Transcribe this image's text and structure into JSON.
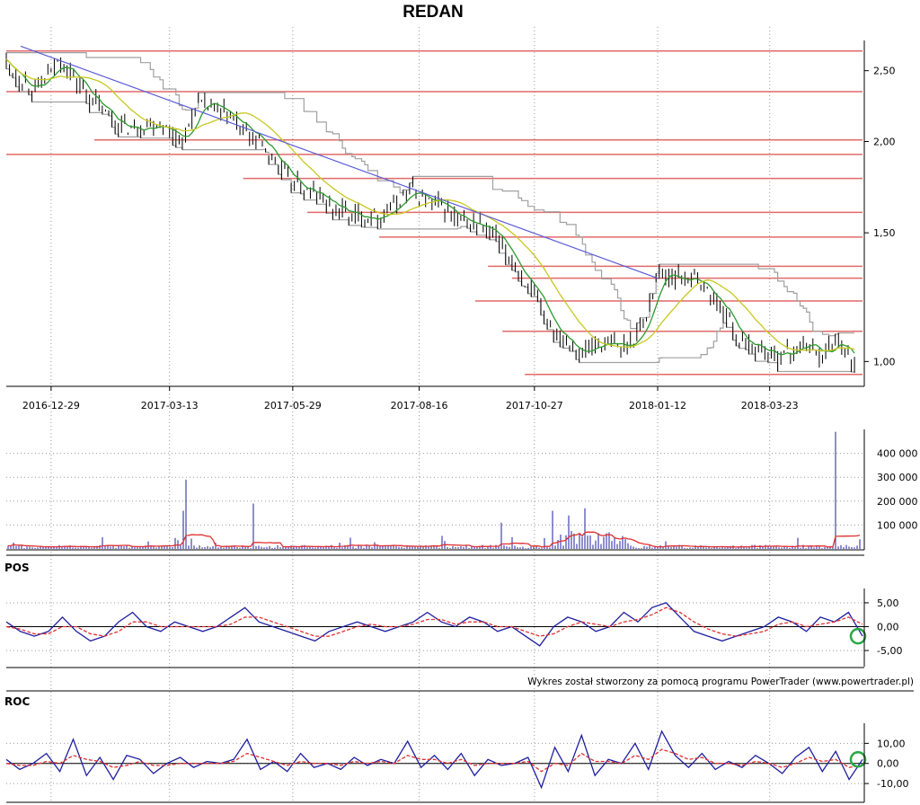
{
  "chart_data": [
    {
      "panel": "price",
      "type": "line",
      "title": "REDAN",
      "y_scale": "log",
      "ylim": [
        0.93,
        2.75
      ],
      "xlim": [
        "2016-12-01",
        "2018-05-20"
      ],
      "x_tick_labels": [
        "2016-12-29",
        "2017-03-13",
        "2017-05-29",
        "2017-08-16",
        "2017-10-27",
        "2018-01-12",
        "2018-03-23"
      ],
      "y_tick_labels": [
        {
          "value": 2.5,
          "label": "2,50"
        },
        {
          "value": 2.0,
          "label": "2,00"
        },
        {
          "value": 1.5,
          "label": "1,50"
        },
        {
          "value": 1.0,
          "label": "1,00"
        }
      ],
      "grid": "dotted-vertical",
      "price_series": [
        {
          "x": "2016-12-01",
          "y": 2.57
        },
        {
          "x": "2016-12-10",
          "y": 2.42
        },
        {
          "x": "2016-12-20",
          "y": 2.36
        },
        {
          "x": "2016-12-29",
          "y": 2.48
        },
        {
          "x": "2017-01-03",
          "y": 2.6
        },
        {
          "x": "2017-01-10",
          "y": 2.48
        },
        {
          "x": "2017-01-20",
          "y": 2.32
        },
        {
          "x": "2017-02-01",
          "y": 2.18
        },
        {
          "x": "2017-02-10",
          "y": 2.1
        },
        {
          "x": "2017-02-20",
          "y": 2.08
        },
        {
          "x": "2017-03-01",
          "y": 2.12
        },
        {
          "x": "2017-03-10",
          "y": 2.1
        },
        {
          "x": "2017-03-15",
          "y": 2.05
        },
        {
          "x": "2017-03-22",
          "y": 2.0
        },
        {
          "x": "2017-03-30",
          "y": 2.25
        },
        {
          "x": "2017-04-10",
          "y": 2.22
        },
        {
          "x": "2017-04-20",
          "y": 2.15
        },
        {
          "x": "2017-05-01",
          "y": 2.05
        },
        {
          "x": "2017-05-10",
          "y": 1.98
        },
        {
          "x": "2017-05-20",
          "y": 1.85
        },
        {
          "x": "2017-05-29",
          "y": 1.75
        },
        {
          "x": "2017-06-10",
          "y": 1.7
        },
        {
          "x": "2017-06-25",
          "y": 1.62
        },
        {
          "x": "2017-07-05",
          "y": 1.58
        },
        {
          "x": "2017-07-20",
          "y": 1.58
        },
        {
          "x": "2017-08-01",
          "y": 1.63
        },
        {
          "x": "2017-08-10",
          "y": 1.72
        },
        {
          "x": "2017-08-20",
          "y": 1.66
        },
        {
          "x": "2017-09-01",
          "y": 1.62
        },
        {
          "x": "2017-09-10",
          "y": 1.55
        },
        {
          "x": "2017-09-25",
          "y": 1.53
        },
        {
          "x": "2017-10-05",
          "y": 1.45
        },
        {
          "x": "2017-10-15",
          "y": 1.35
        },
        {
          "x": "2017-10-27",
          "y": 1.22
        },
        {
          "x": "2017-11-05",
          "y": 1.12
        },
        {
          "x": "2017-11-15",
          "y": 1.08
        },
        {
          "x": "2017-11-25",
          "y": 1.02
        },
        {
          "x": "2017-12-05",
          "y": 1.06
        },
        {
          "x": "2017-12-15",
          "y": 1.05
        },
        {
          "x": "2017-12-25",
          "y": 1.05
        },
        {
          "x": "2018-01-05",
          "y": 1.15
        },
        {
          "x": "2018-01-12",
          "y": 1.33
        },
        {
          "x": "2018-01-25",
          "y": 1.3
        },
        {
          "x": "2018-02-05",
          "y": 1.3
        },
        {
          "x": "2018-02-15",
          "y": 1.22
        },
        {
          "x": "2018-02-25",
          "y": 1.15
        },
        {
          "x": "2018-03-05",
          "y": 1.05
        },
        {
          "x": "2018-03-15",
          "y": 1.05
        },
        {
          "x": "2018-03-23",
          "y": 1.02
        },
        {
          "x": "2018-04-05",
          "y": 1.03
        },
        {
          "x": "2018-04-15",
          "y": 1.06
        },
        {
          "x": "2018-04-25",
          "y": 1.02
        },
        {
          "x": "2018-05-05",
          "y": 1.08
        },
        {
          "x": "2018-05-15",
          "y": 0.98
        }
      ],
      "trendline": {
        "from": {
          "x": "2016-12-10",
          "y": 2.7
        },
        "to": {
          "x": "2018-01-12",
          "y": 1.3
        },
        "color": "#5b5bd6"
      },
      "horizontal_levels": [
        {
          "y": 2.66,
          "from": "2016-12-01"
        },
        {
          "y": 2.34,
          "from": "2016-12-01"
        },
        {
          "y": 2.01,
          "from": "2017-01-25"
        },
        {
          "y": 1.92,
          "from": "2016-12-01"
        },
        {
          "y": 1.78,
          "from": "2017-04-28"
        },
        {
          "y": 1.6,
          "from": "2017-06-07"
        },
        {
          "y": 1.48,
          "from": "2017-07-22"
        },
        {
          "y": 1.35,
          "from": "2017-09-28"
        },
        {
          "y": 1.3,
          "from": "2017-10-13"
        },
        {
          "y": 1.21,
          "from": "2017-09-20"
        },
        {
          "y": 1.1,
          "from": "2017-10-07"
        },
        {
          "y": 0.96,
          "from": "2017-10-21"
        }
      ],
      "colors": {
        "price": "#000000",
        "ma_fast": "#2e9a2e",
        "ma_slow": "#c8c820",
        "channel": "#a0a0a0",
        "levels": "#e06a6a"
      }
    },
    {
      "panel": "volume",
      "type": "bar",
      "ylim": [
        0,
        500000
      ],
      "y_tick_labels": [
        {
          "value": 100000,
          "label": "100 000"
        },
        {
          "value": 200000,
          "label": "200 000"
        },
        {
          "value": 300000,
          "label": "300 000"
        },
        {
          "value": 400000,
          "label": "400 000"
        }
      ],
      "spikes": [
        {
          "x": "2017-03-23",
          "y": 290000
        },
        {
          "x": "2017-03-21",
          "y": 160000
        },
        {
          "x": "2017-05-04",
          "y": 190000
        },
        {
          "x": "2017-11-08",
          "y": 160000
        },
        {
          "x": "2017-11-28",
          "y": 170000
        },
        {
          "x": "2018-05-03",
          "y": 490000
        },
        {
          "x": "2017-10-07",
          "y": 110000
        },
        {
          "x": "2017-11-18",
          "y": 140000
        }
      ],
      "colors": {
        "bars": "#1e1ea0",
        "average": "#e03030"
      }
    },
    {
      "panel": "POS",
      "type": "line",
      "label": "POS",
      "ylim": [
        -8,
        8
      ],
      "y_tick_labels": [
        {
          "value": 5,
          "label": "5,00"
        },
        {
          "value": 0,
          "label": "0,00"
        },
        {
          "value": -5,
          "label": "-5,00"
        }
      ],
      "series": [
        {
          "values": [
            1,
            -1,
            -2,
            -1,
            2,
            -1,
            -3,
            -2,
            1,
            3,
            0,
            -1,
            1,
            0,
            -1,
            0,
            2,
            4,
            1,
            0,
            -1,
            -2,
            -3,
            -1,
            0,
            1,
            0,
            -1,
            0,
            1,
            3,
            1,
            0,
            2,
            1,
            -1,
            0,
            -2,
            -4,
            0,
            2,
            1,
            -1,
            0,
            3,
            1,
            4,
            5,
            2,
            -1,
            -2,
            -3,
            -2,
            -1,
            0,
            2,
            1,
            -1,
            2,
            1,
            3,
            -2
          ]
        },
        {
          "values": [
            0,
            -0.5,
            -1.5,
            -1.5,
            0,
            0,
            -1.5,
            -2,
            -1,
            1,
            1,
            0,
            0,
            0,
            0,
            0,
            0.5,
            2,
            2,
            1,
            0,
            -1,
            -2,
            -2,
            -1,
            0,
            0.5,
            0,
            0,
            0.5,
            1.5,
            1.5,
            0.5,
            1,
            1,
            0,
            0,
            -1,
            -2,
            -1.5,
            0,
            1,
            0.5,
            0,
            1,
            1.5,
            2.5,
            4,
            3,
            1,
            -0.5,
            -1.5,
            -2,
            -1.5,
            -1,
            0.5,
            1,
            0,
            0.5,
            1,
            2,
            0.5
          ]
        }
      ],
      "colors": {
        "series_1": "#1e1ea0",
        "series_2": "#e03030"
      }
    },
    {
      "panel": "ROC",
      "type": "line",
      "label": "ROC",
      "ylim": [
        -18,
        20
      ],
      "y_tick_labels": [
        {
          "value": 10,
          "label": "10,00"
        },
        {
          "value": 0,
          "label": "0,00"
        },
        {
          "value": -10,
          "label": "-10,00"
        }
      ],
      "series": [
        {
          "values": [
            2,
            -3,
            0,
            5,
            -4,
            12,
            -6,
            3,
            -8,
            4,
            2,
            -5,
            0,
            3,
            -2,
            1,
            0,
            2,
            12,
            -3,
            1,
            -4,
            5,
            -2,
            0,
            -3,
            3,
            -1,
            2,
            0,
            11,
            -2,
            4,
            -3,
            5,
            -6,
            2,
            -1,
            0,
            3,
            -12,
            8,
            -4,
            14,
            -6,
            2,
            0,
            10,
            -3,
            16,
            4,
            -2,
            5,
            -3,
            1,
            -2,
            4,
            0,
            -5,
            3,
            8,
            -4,
            6,
            -8,
            2
          ]
        },
        {
          "values": [
            0,
            -1,
            -1,
            1,
            0,
            4,
            2,
            1,
            -2,
            -1,
            1,
            -1,
            -1,
            0,
            0,
            0,
            0,
            1,
            5,
            3,
            1,
            -1,
            1,
            0,
            0,
            -1,
            1,
            0,
            1,
            0,
            4,
            2,
            2,
            0,
            2,
            -1,
            0,
            0,
            0,
            1,
            -4,
            0,
            -1,
            5,
            1,
            1,
            0,
            4,
            2,
            7,
            5,
            2,
            3,
            0,
            0,
            -1,
            1,
            0,
            -2,
            0,
            3,
            1,
            2,
            -2,
            -1
          ]
        }
      ],
      "colors": {
        "series_1": "#1e1ea0",
        "series_2": "#e03030"
      }
    }
  ],
  "credit": "Wykres został stworzony za pomocą programu PowerTrader (www.powertrader.pl)",
  "marker_color": "#28a745"
}
